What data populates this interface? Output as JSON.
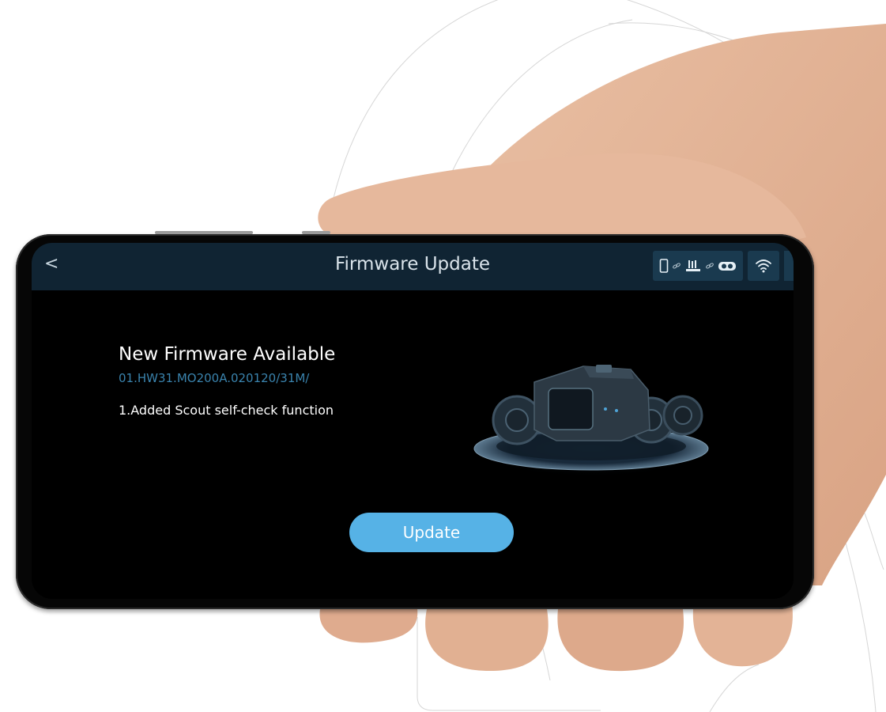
{
  "header": {
    "back_label": "<",
    "title": "Firmware Update",
    "status_icons": [
      "phone-icon",
      "link-icon",
      "router-icon",
      "link-icon",
      "goggles-icon"
    ],
    "wifi_icon": "wifi-icon"
  },
  "firmware": {
    "heading": "New Firmware Available",
    "version": "01.HW31.MO200A.020120/31M/",
    "notes": [
      "1.Added Scout self-check function"
    ]
  },
  "actions": {
    "update_label": "Update"
  },
  "colors": {
    "topbar_bg": "#102433",
    "status_box_bg": "#1a3a4f",
    "version_text": "#3a83ad",
    "update_button": "#56b2e6",
    "screen_bg": "#000000"
  }
}
